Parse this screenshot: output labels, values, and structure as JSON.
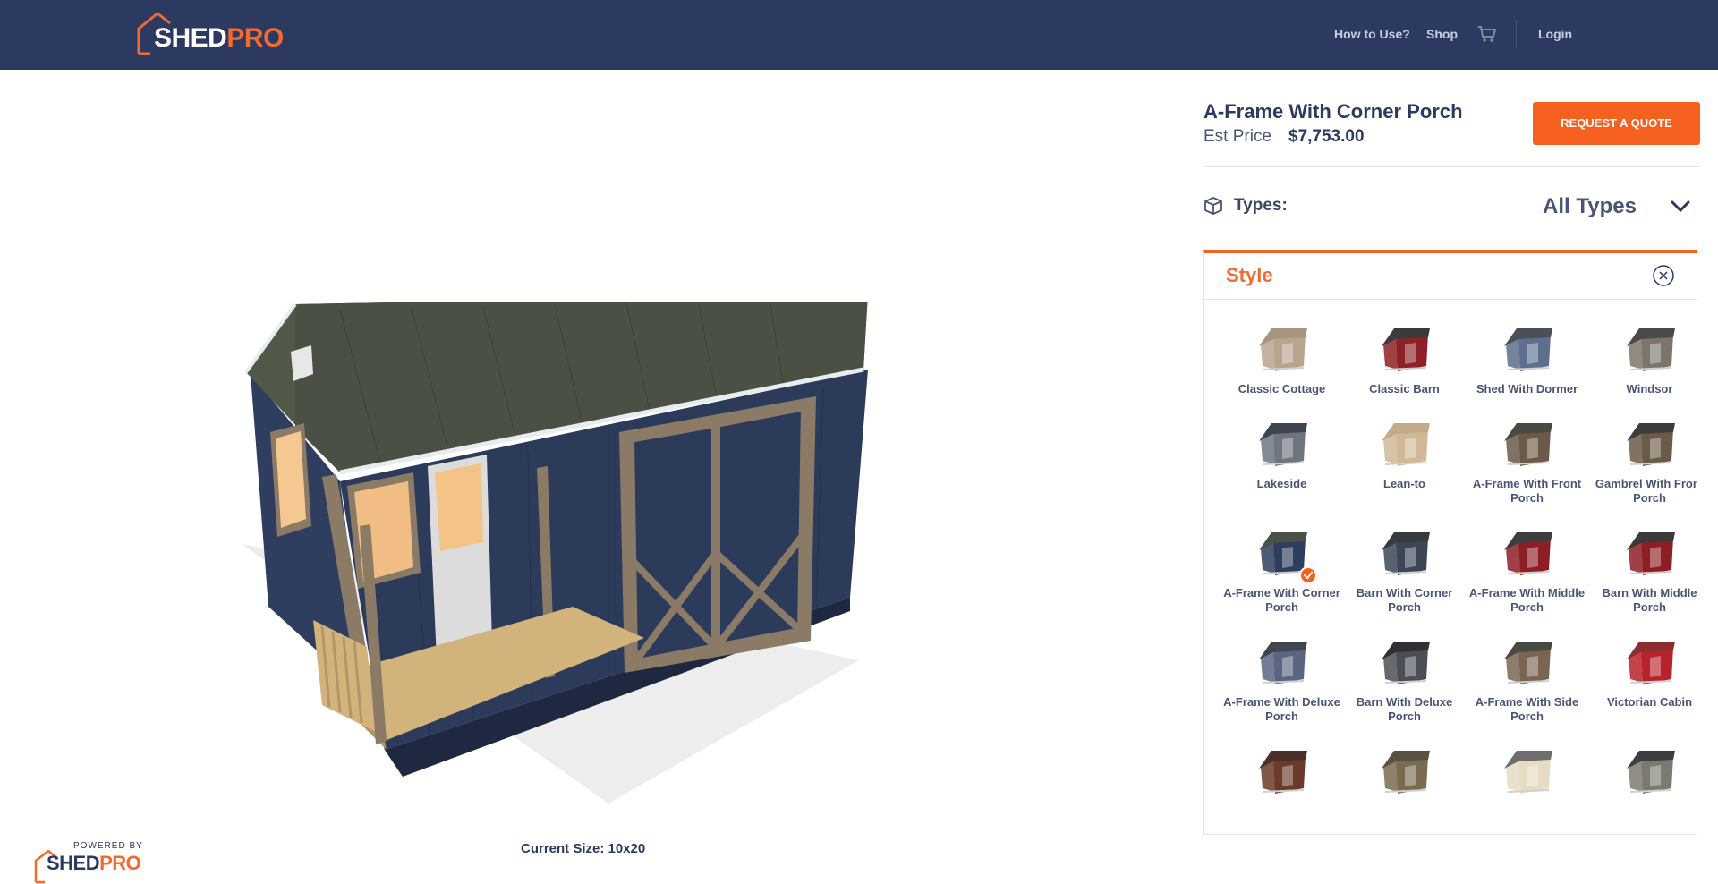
{
  "brand": {
    "logo_word1": "SHED",
    "logo_word2": "PRO",
    "accent": "#f26a2e",
    "navy": "#2c3a62"
  },
  "nav": {
    "how_to_use": "How to Use?",
    "shop": "Shop",
    "cart_icon": "cart-icon",
    "login": "Login"
  },
  "product": {
    "title": "A-Frame With Corner Porch",
    "est_label": "Est Price",
    "est_price": "$7,753.00",
    "quote_button": "REQUEST A QUOTE"
  },
  "types": {
    "label": "Types:",
    "value": "All Types"
  },
  "style": {
    "title": "Style",
    "items": [
      {
        "label": "Classic Cottage",
        "color": "#b9a48e",
        "roof": "#a89580"
      },
      {
        "label": "Classic Barn",
        "color": "#8e2128",
        "roof": "#3b3b3b"
      },
      {
        "label": "Shed With Dormer",
        "color": "#5d6f8c",
        "roof": "#4a4f58"
      },
      {
        "label": "Windsor",
        "color": "#7c766a",
        "roof": "#4a4a4a"
      },
      {
        "label": "Lakeside",
        "color": "#6e7580",
        "roof": "#3f4450"
      },
      {
        "label": "Lean-to",
        "color": "#d0b896",
        "roof": "#c4ab88"
      },
      {
        "label": "A-Frame With Front Porch",
        "color": "#6b5a48",
        "roof": "#4a4a44"
      },
      {
        "label": "Gambrel With Front Porch",
        "color": "#6a5a48",
        "roof": "#3d3d3d"
      },
      {
        "label": "A-Frame With Corner Porch",
        "color": "#2f3e5e",
        "roof": "#4a5046",
        "selected": true
      },
      {
        "label": "Barn With Corner Porch",
        "color": "#3c4657",
        "roof": "#363b3e"
      },
      {
        "label": "A-Frame With Middle Porch",
        "color": "#8e1e26",
        "roof": "#3e3e3e"
      },
      {
        "label": "Barn With Middle Porch",
        "color": "#8e1e26",
        "roof": "#3a3a3a"
      },
      {
        "label": "A-Frame With Deluxe Porch",
        "color": "#5a6680",
        "roof": "#40464e"
      },
      {
        "label": "Barn With Deluxe Porch",
        "color": "#4b4f55",
        "roof": "#2e3034"
      },
      {
        "label": "A-Frame With Side Porch",
        "color": "#7a6552",
        "roof": "#4a4a44"
      },
      {
        "label": "Victorian Cabin",
        "color": "#b8222a",
        "roof": "#8c2e2e"
      },
      {
        "label": "",
        "color": "#6b3a2a",
        "roof": "#4a3028"
      },
      {
        "label": "",
        "color": "#7a6a50",
        "roof": "#5a5044"
      },
      {
        "label": "",
        "color": "#e6dcc4",
        "roof": "#6e6e6e"
      },
      {
        "label": "",
        "color": "#7c7a70",
        "roof": "#3e3e3e"
      }
    ]
  },
  "viewer": {
    "current_size": "Current Size: 10x20",
    "powered_by": "POWERED BY"
  }
}
